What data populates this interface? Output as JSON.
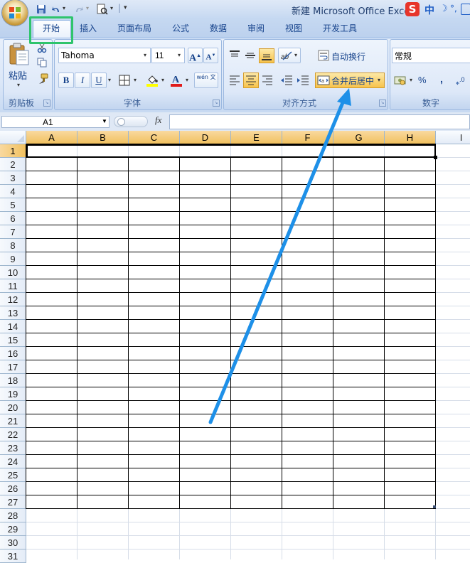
{
  "window": {
    "title": "新建 Microsoft Office Excel"
  },
  "ime": {
    "label": "中"
  },
  "tabs": [
    "开始",
    "插入",
    "页面布局",
    "公式",
    "数据",
    "审阅",
    "视图",
    "开发工具"
  ],
  "clipboard": {
    "paste_label": "粘贴",
    "group_label": "剪贴板"
  },
  "font": {
    "name": "Tahoma",
    "size": "11",
    "group_label": "字体",
    "bold": "B",
    "italic": "I",
    "underline": "U",
    "phonetic": "wén 文"
  },
  "alignment": {
    "wrap_label": "自动换行",
    "merge_label": "合并后居中",
    "group_label": "对齐方式"
  },
  "number": {
    "format": "常规",
    "percent": "%",
    "comma": ",",
    "group_label": "数字"
  },
  "formula_bar": {
    "cell_ref": "A1",
    "fx": "fx",
    "value": ""
  },
  "columns": [
    "A",
    "B",
    "C",
    "D",
    "E",
    "F",
    "G",
    "H",
    "I"
  ],
  "rows": [
    "1",
    "2",
    "3",
    "4",
    "5",
    "6",
    "7",
    "8",
    "9",
    "10",
    "11",
    "12",
    "13",
    "14",
    "15",
    "16",
    "17",
    "18",
    "19",
    "20",
    "21",
    "22",
    "23",
    "24",
    "25",
    "26",
    "27",
    "28",
    "29",
    "30",
    "31"
  ],
  "selected_cell": "A1",
  "merged_range": "A1:H1",
  "bordered_range": "A1:H27",
  "annotation": {
    "highlight_color": "#2fc46c",
    "arrow_color": "#1e90e8"
  }
}
